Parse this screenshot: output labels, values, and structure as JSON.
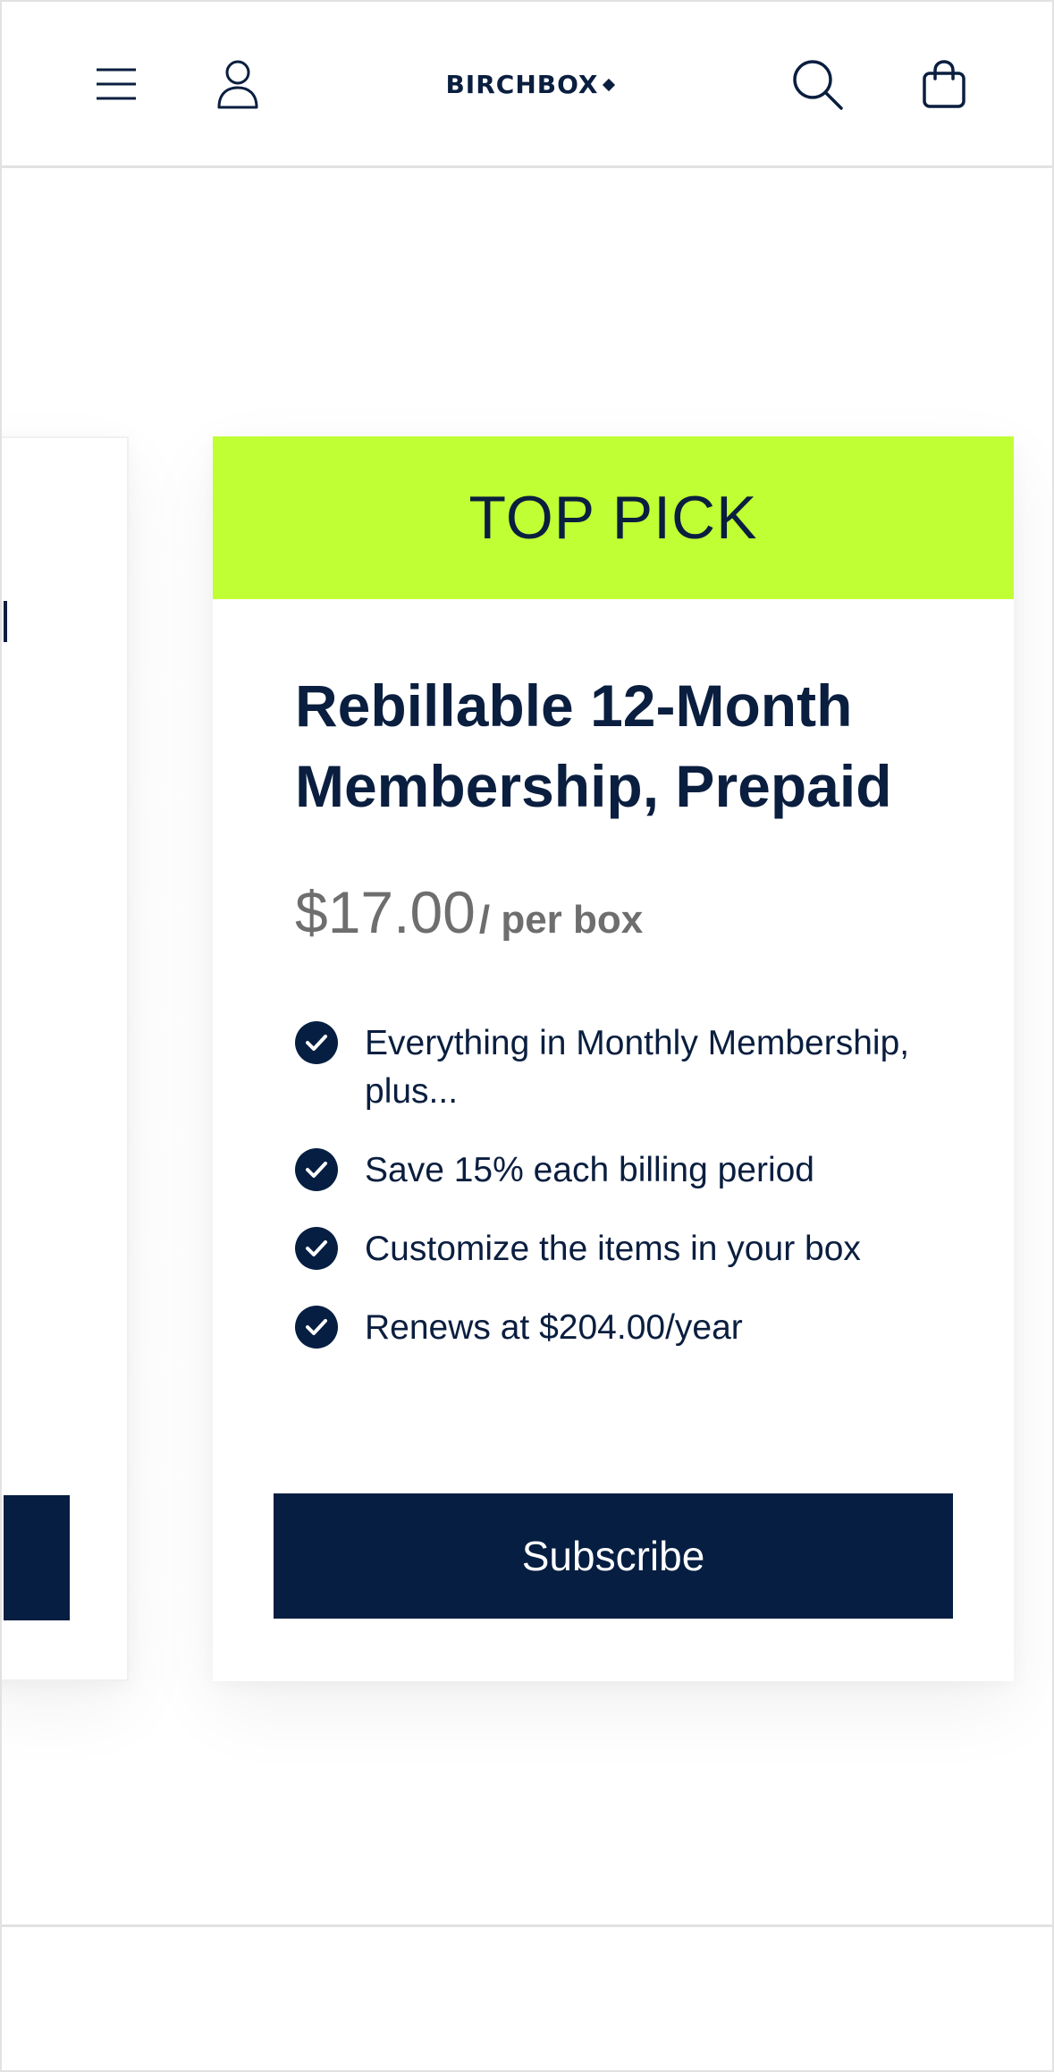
{
  "header": {
    "logo": "BIRCHBOX",
    "icons": {
      "menu": "hamburger-menu-icon",
      "account": "user-icon",
      "search": "search-icon",
      "bag": "shopping-bag-icon"
    }
  },
  "plan": {
    "badge": "TOP PICK",
    "title": "Rebillable 12-Month Membership, Prepaid",
    "price": "$17.00",
    "price_unit": "/ per box",
    "features": [
      "Everything in Monthly Membership, plus...",
      "Save 15% each billing period",
      "Customize the items in your box",
      "Renews at $204.00/year"
    ],
    "cta": "Subscribe"
  },
  "colors": {
    "navy": "#051e42",
    "badge_green": "#c0ff33",
    "price_gray": "#6e6e6e"
  }
}
